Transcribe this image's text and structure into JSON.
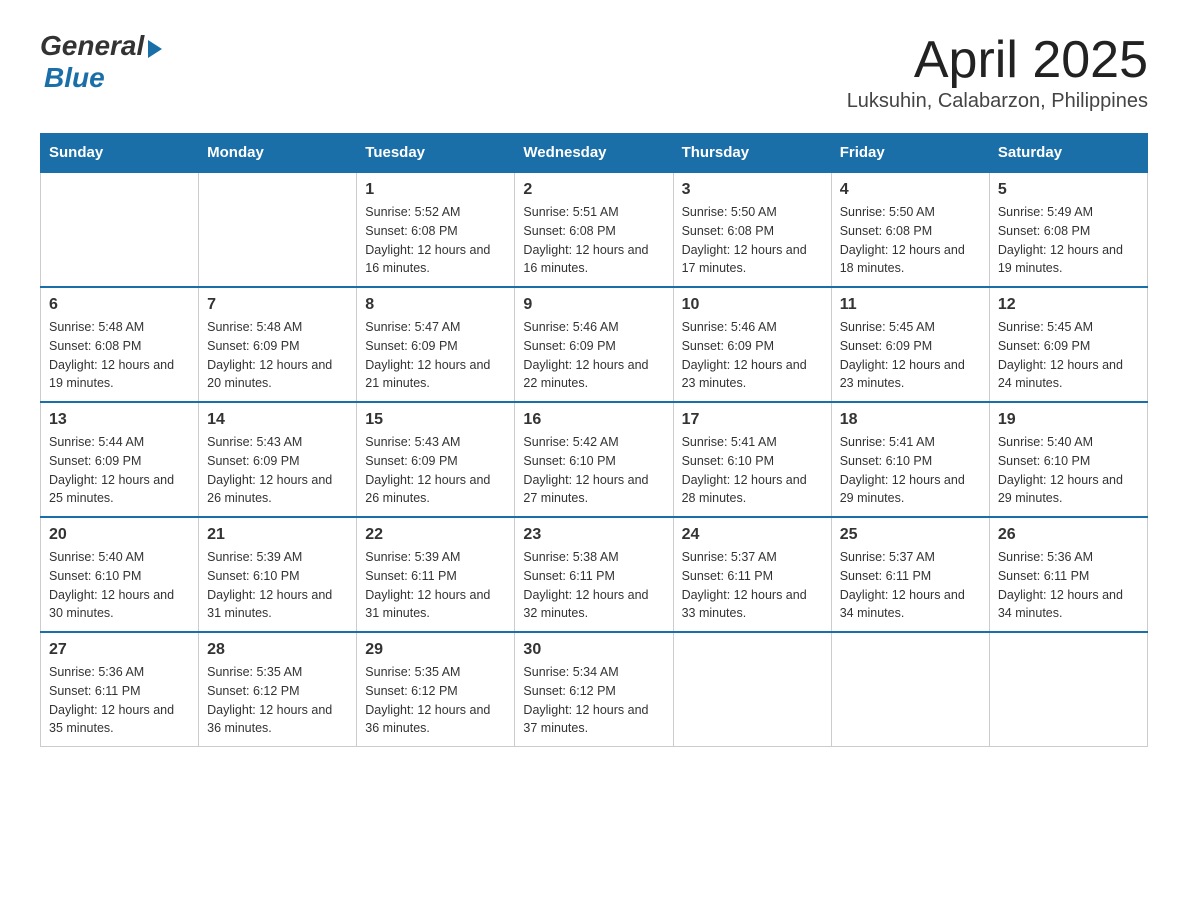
{
  "logo": {
    "general": "General",
    "blue": "Blue"
  },
  "title": "April 2025",
  "subtitle": "Luksuhin, Calabarzon, Philippines",
  "weekdays": [
    "Sunday",
    "Monday",
    "Tuesday",
    "Wednesday",
    "Thursday",
    "Friday",
    "Saturday"
  ],
  "weeks": [
    [
      {
        "day": "",
        "sunrise": "",
        "sunset": "",
        "daylight": ""
      },
      {
        "day": "",
        "sunrise": "",
        "sunset": "",
        "daylight": ""
      },
      {
        "day": "1",
        "sunrise": "Sunrise: 5:52 AM",
        "sunset": "Sunset: 6:08 PM",
        "daylight": "Daylight: 12 hours and 16 minutes."
      },
      {
        "day": "2",
        "sunrise": "Sunrise: 5:51 AM",
        "sunset": "Sunset: 6:08 PM",
        "daylight": "Daylight: 12 hours and 16 minutes."
      },
      {
        "day": "3",
        "sunrise": "Sunrise: 5:50 AM",
        "sunset": "Sunset: 6:08 PM",
        "daylight": "Daylight: 12 hours and 17 minutes."
      },
      {
        "day": "4",
        "sunrise": "Sunrise: 5:50 AM",
        "sunset": "Sunset: 6:08 PM",
        "daylight": "Daylight: 12 hours and 18 minutes."
      },
      {
        "day": "5",
        "sunrise": "Sunrise: 5:49 AM",
        "sunset": "Sunset: 6:08 PM",
        "daylight": "Daylight: 12 hours and 19 minutes."
      }
    ],
    [
      {
        "day": "6",
        "sunrise": "Sunrise: 5:48 AM",
        "sunset": "Sunset: 6:08 PM",
        "daylight": "Daylight: 12 hours and 19 minutes."
      },
      {
        "day": "7",
        "sunrise": "Sunrise: 5:48 AM",
        "sunset": "Sunset: 6:09 PM",
        "daylight": "Daylight: 12 hours and 20 minutes."
      },
      {
        "day": "8",
        "sunrise": "Sunrise: 5:47 AM",
        "sunset": "Sunset: 6:09 PM",
        "daylight": "Daylight: 12 hours and 21 minutes."
      },
      {
        "day": "9",
        "sunrise": "Sunrise: 5:46 AM",
        "sunset": "Sunset: 6:09 PM",
        "daylight": "Daylight: 12 hours and 22 minutes."
      },
      {
        "day": "10",
        "sunrise": "Sunrise: 5:46 AM",
        "sunset": "Sunset: 6:09 PM",
        "daylight": "Daylight: 12 hours and 23 minutes."
      },
      {
        "day": "11",
        "sunrise": "Sunrise: 5:45 AM",
        "sunset": "Sunset: 6:09 PM",
        "daylight": "Daylight: 12 hours and 23 minutes."
      },
      {
        "day": "12",
        "sunrise": "Sunrise: 5:45 AM",
        "sunset": "Sunset: 6:09 PM",
        "daylight": "Daylight: 12 hours and 24 minutes."
      }
    ],
    [
      {
        "day": "13",
        "sunrise": "Sunrise: 5:44 AM",
        "sunset": "Sunset: 6:09 PM",
        "daylight": "Daylight: 12 hours and 25 minutes."
      },
      {
        "day": "14",
        "sunrise": "Sunrise: 5:43 AM",
        "sunset": "Sunset: 6:09 PM",
        "daylight": "Daylight: 12 hours and 26 minutes."
      },
      {
        "day": "15",
        "sunrise": "Sunrise: 5:43 AM",
        "sunset": "Sunset: 6:09 PM",
        "daylight": "Daylight: 12 hours and 26 minutes."
      },
      {
        "day": "16",
        "sunrise": "Sunrise: 5:42 AM",
        "sunset": "Sunset: 6:10 PM",
        "daylight": "Daylight: 12 hours and 27 minutes."
      },
      {
        "day": "17",
        "sunrise": "Sunrise: 5:41 AM",
        "sunset": "Sunset: 6:10 PM",
        "daylight": "Daylight: 12 hours and 28 minutes."
      },
      {
        "day": "18",
        "sunrise": "Sunrise: 5:41 AM",
        "sunset": "Sunset: 6:10 PM",
        "daylight": "Daylight: 12 hours and 29 minutes."
      },
      {
        "day": "19",
        "sunrise": "Sunrise: 5:40 AM",
        "sunset": "Sunset: 6:10 PM",
        "daylight": "Daylight: 12 hours and 29 minutes."
      }
    ],
    [
      {
        "day": "20",
        "sunrise": "Sunrise: 5:40 AM",
        "sunset": "Sunset: 6:10 PM",
        "daylight": "Daylight: 12 hours and 30 minutes."
      },
      {
        "day": "21",
        "sunrise": "Sunrise: 5:39 AM",
        "sunset": "Sunset: 6:10 PM",
        "daylight": "Daylight: 12 hours and 31 minutes."
      },
      {
        "day": "22",
        "sunrise": "Sunrise: 5:39 AM",
        "sunset": "Sunset: 6:11 PM",
        "daylight": "Daylight: 12 hours and 31 minutes."
      },
      {
        "day": "23",
        "sunrise": "Sunrise: 5:38 AM",
        "sunset": "Sunset: 6:11 PM",
        "daylight": "Daylight: 12 hours and 32 minutes."
      },
      {
        "day": "24",
        "sunrise": "Sunrise: 5:37 AM",
        "sunset": "Sunset: 6:11 PM",
        "daylight": "Daylight: 12 hours and 33 minutes."
      },
      {
        "day": "25",
        "sunrise": "Sunrise: 5:37 AM",
        "sunset": "Sunset: 6:11 PM",
        "daylight": "Daylight: 12 hours and 34 minutes."
      },
      {
        "day": "26",
        "sunrise": "Sunrise: 5:36 AM",
        "sunset": "Sunset: 6:11 PM",
        "daylight": "Daylight: 12 hours and 34 minutes."
      }
    ],
    [
      {
        "day": "27",
        "sunrise": "Sunrise: 5:36 AM",
        "sunset": "Sunset: 6:11 PM",
        "daylight": "Daylight: 12 hours and 35 minutes."
      },
      {
        "day": "28",
        "sunrise": "Sunrise: 5:35 AM",
        "sunset": "Sunset: 6:12 PM",
        "daylight": "Daylight: 12 hours and 36 minutes."
      },
      {
        "day": "29",
        "sunrise": "Sunrise: 5:35 AM",
        "sunset": "Sunset: 6:12 PM",
        "daylight": "Daylight: 12 hours and 36 minutes."
      },
      {
        "day": "30",
        "sunrise": "Sunrise: 5:34 AM",
        "sunset": "Sunset: 6:12 PM",
        "daylight": "Daylight: 12 hours and 37 minutes."
      },
      {
        "day": "",
        "sunrise": "",
        "sunset": "",
        "daylight": ""
      },
      {
        "day": "",
        "sunrise": "",
        "sunset": "",
        "daylight": ""
      },
      {
        "day": "",
        "sunrise": "",
        "sunset": "",
        "daylight": ""
      }
    ]
  ]
}
